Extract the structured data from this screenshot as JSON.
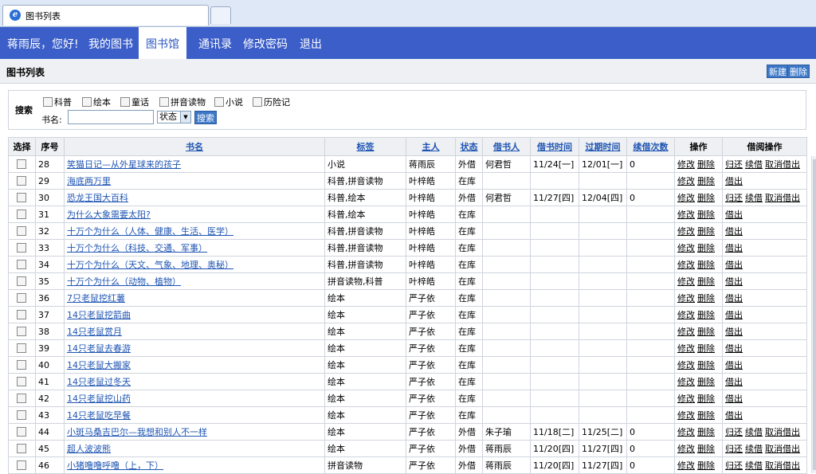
{
  "browser": {
    "tab_title": "图书列表"
  },
  "nav": {
    "greeting": "蒋雨辰，您好!",
    "items": [
      "我的图书",
      "图书馆",
      "通讯录",
      "修改密码",
      "退出"
    ]
  },
  "header": {
    "title": "图书列表",
    "new_label": "新建",
    "delete_label": "删除"
  },
  "search": {
    "label": "搜索",
    "categories": [
      "科普",
      "绘本",
      "童话",
      "拼音读物",
      "小说",
      "历险记"
    ],
    "name_label": "书名:",
    "name_value": "",
    "status_value": "状态",
    "search_button": "搜索"
  },
  "table": {
    "columns": [
      "选择",
      "序号",
      "书名",
      "标签",
      "主人",
      "状态",
      "借书人",
      "借书时间",
      "过期时间",
      "续借次数",
      "操作",
      "借阅操作"
    ],
    "op_edit": "修改",
    "op_delete": "删除",
    "op_return": "归还",
    "op_renew": "续借",
    "op_cancel": "取消借出",
    "op_lend": "借出",
    "rows": [
      {
        "no": "28",
        "name": "笑猫日记—从外星球来的孩子",
        "tags": "小说",
        "owner": "蒋雨辰",
        "status": "外借",
        "borrower": "何君哲",
        "borrow_time": "11/24[一]",
        "due_time": "12/01[一]",
        "renew": "0"
      },
      {
        "no": "29",
        "name": "海底两万里",
        "tags": "科普,拼音读物",
        "owner": "叶梓皓",
        "status": "在库",
        "borrower": "",
        "borrow_time": "",
        "due_time": "",
        "renew": ""
      },
      {
        "no": "30",
        "name": "恐龙王国大百科",
        "tags": "科普,绘本",
        "owner": "叶梓皓",
        "status": "外借",
        "borrower": "何君哲",
        "borrow_time": "11/27[四]",
        "due_time": "12/04[四]",
        "renew": "0"
      },
      {
        "no": "31",
        "name": "为什么大象需要太阳?",
        "tags": "科普,绘本",
        "owner": "叶梓皓",
        "status": "在库",
        "borrower": "",
        "borrow_time": "",
        "due_time": "",
        "renew": ""
      },
      {
        "no": "32",
        "name": "十万个为什么（人体、健康、生活、医学）",
        "tags": "科普,拼音读物",
        "owner": "叶梓皓",
        "status": "在库",
        "borrower": "",
        "borrow_time": "",
        "due_time": "",
        "renew": ""
      },
      {
        "no": "33",
        "name": "十万个为什么（科技、交通、军事）",
        "tags": "科普,拼音读物",
        "owner": "叶梓皓",
        "status": "在库",
        "borrower": "",
        "borrow_time": "",
        "due_time": "",
        "renew": ""
      },
      {
        "no": "34",
        "name": "十万个为什么（天文、气象、地理、奥秘）",
        "tags": "科普,拼音读物",
        "owner": "叶梓皓",
        "status": "在库",
        "borrower": "",
        "borrow_time": "",
        "due_time": "",
        "renew": ""
      },
      {
        "no": "35",
        "name": "十万个为什么（动物、植物）",
        "tags": "拼音读物,科普",
        "owner": "叶梓皓",
        "status": "在库",
        "borrower": "",
        "borrow_time": "",
        "due_time": "",
        "renew": ""
      },
      {
        "no": "36",
        "name": "7只老鼠挖红薯",
        "tags": "绘本",
        "owner": "严子依",
        "status": "在库",
        "borrower": "",
        "borrow_time": "",
        "due_time": "",
        "renew": ""
      },
      {
        "no": "37",
        "name": "14只老鼠挖箭曲",
        "tags": "绘本",
        "owner": "严子依",
        "status": "在库",
        "borrower": "",
        "borrow_time": "",
        "due_time": "",
        "renew": ""
      },
      {
        "no": "38",
        "name": "14只老鼠赏月",
        "tags": "绘本",
        "owner": "严子依",
        "status": "在库",
        "borrower": "",
        "borrow_time": "",
        "due_time": "",
        "renew": ""
      },
      {
        "no": "39",
        "name": "14只老鼠去春游",
        "tags": "绘本",
        "owner": "严子依",
        "status": "在库",
        "borrower": "",
        "borrow_time": "",
        "due_time": "",
        "renew": ""
      },
      {
        "no": "40",
        "name": "14只老鼠大搬家",
        "tags": "绘本",
        "owner": "严子依",
        "status": "在库",
        "borrower": "",
        "borrow_time": "",
        "due_time": "",
        "renew": ""
      },
      {
        "no": "41",
        "name": "14只老鼠过冬天",
        "tags": "绘本",
        "owner": "严子依",
        "status": "在库",
        "borrower": "",
        "borrow_time": "",
        "due_time": "",
        "renew": ""
      },
      {
        "no": "42",
        "name": "14只老鼠挖山药",
        "tags": "绘本",
        "owner": "严子依",
        "status": "在库",
        "borrower": "",
        "borrow_time": "",
        "due_time": "",
        "renew": ""
      },
      {
        "no": "43",
        "name": "14只老鼠吃早餐",
        "tags": "绘本",
        "owner": "严子依",
        "status": "在库",
        "borrower": "",
        "borrow_time": "",
        "due_time": "",
        "renew": ""
      },
      {
        "no": "44",
        "name": "小斑马桑吉巴尔—我想和别人不一样",
        "tags": "绘本",
        "owner": "严子依",
        "status": "外借",
        "borrower": "朱子瑜",
        "borrow_time": "11/18[二]",
        "due_time": "11/25[二]",
        "renew": "0"
      },
      {
        "no": "45",
        "name": "超人波波熊",
        "tags": "绘本",
        "owner": "严子依",
        "status": "外借",
        "borrower": "蒋雨辰",
        "borrow_time": "11/20[四]",
        "due_time": "11/27[四]",
        "renew": "0"
      },
      {
        "no": "46",
        "name": "小猪噜噜呼噜（上，下）",
        "tags": "拼音读物",
        "owner": "严子依",
        "status": "外借",
        "borrower": "蒋雨辰",
        "borrow_time": "11/20[四]",
        "due_time": "11/27[四]",
        "renew": "0"
      }
    ]
  }
}
